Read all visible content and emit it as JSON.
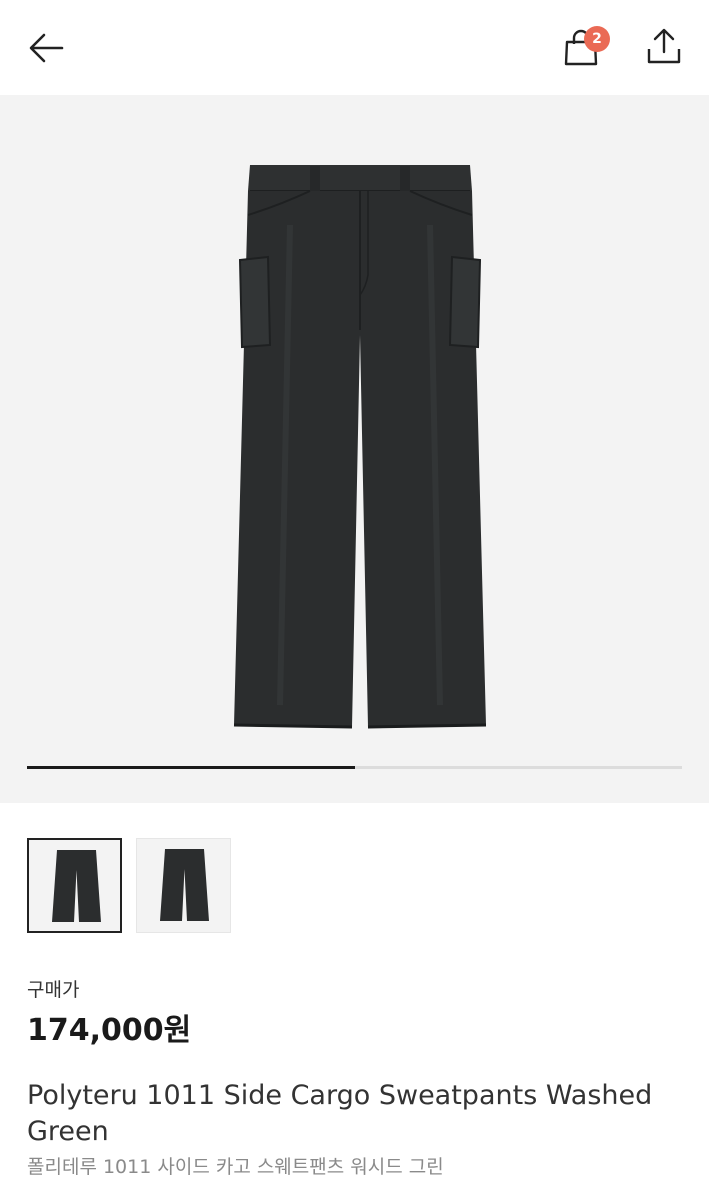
{
  "header": {
    "back_icon": "arrow-left-icon",
    "cart_icon": "shopping-bag-icon",
    "cart_count": "2",
    "share_icon": "share-upload-icon"
  },
  "gallery": {
    "current_image": "pants-front",
    "image_count": 2,
    "current_index": 1,
    "progress_fraction": 0.5
  },
  "thumbnails": [
    {
      "image": "pants-front",
      "selected": true
    },
    {
      "image": "pants-back",
      "selected": false
    }
  ],
  "product": {
    "price_label": "구매가",
    "price": "174,000원",
    "title_en": "Polyteru 1011 Side Cargo Sweatpants Washed Green",
    "title_ko": "폴리테루 1011 사이드 카고 스웨트팬츠 워시드 그린"
  },
  "colors": {
    "badge": "#ea6a55",
    "product": "#2b2d2e",
    "gallery_bg": "#f3f3f3"
  }
}
